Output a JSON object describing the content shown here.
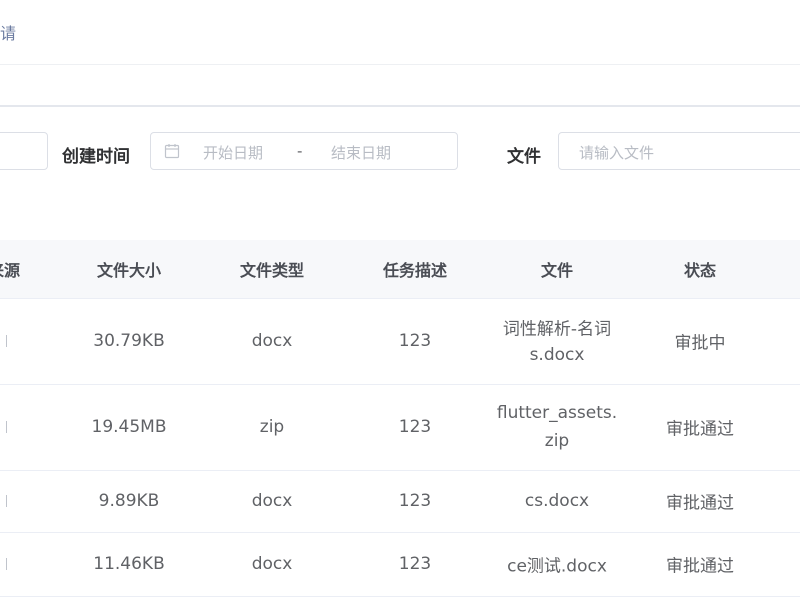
{
  "breadcrumb": {
    "tail": "请"
  },
  "filters": {
    "created_time_label": "创建时间",
    "start_placeholder": "开始日期",
    "range_separator": "-",
    "end_placeholder": "结束日期",
    "file_label": "文件",
    "file_placeholder": "请输入文件"
  },
  "table": {
    "headers": [
      "来源",
      "文件大小",
      "文件类型",
      "任务描述",
      "文件",
      "状态"
    ],
    "rows": [
      {
        "size": "30.79KB",
        "type": "docx",
        "desc": "123",
        "file_line1": "词性解析-名词",
        "file_line2": "s.docx",
        "status": "审批中"
      },
      {
        "size": "19.45MB",
        "type": "zip",
        "desc": "123",
        "file_line1": "flutter_assets.",
        "file_line2": "zip",
        "status": "审批通过"
      },
      {
        "size": "9.89KB",
        "type": "docx",
        "desc": "123",
        "file_line1": "cs.docx",
        "file_line2": "",
        "status": "审批通过"
      },
      {
        "size": "11.46KB",
        "type": "docx",
        "desc": "123",
        "file_line1": "ce测试.docx",
        "file_line2": "",
        "status": "审批通过"
      }
    ]
  },
  "icons": {
    "calendar": "calendar-icon"
  }
}
